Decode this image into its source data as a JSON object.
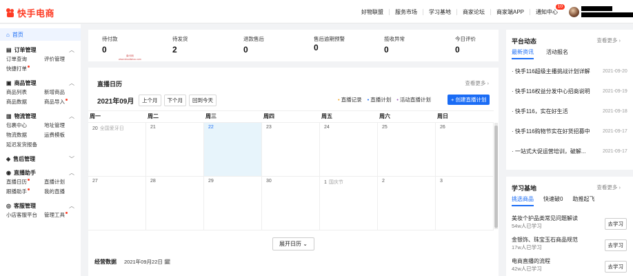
{
  "header": {
    "logo_text": "快手电商",
    "nav": [
      "好物联盟",
      "服务市场",
      "学习基地",
      "商家论坛",
      "商家端APP",
      "通知中心"
    ],
    "notification_count": "10"
  },
  "sidebar": {
    "home": "首页",
    "groups": [
      {
        "title": "订单管理",
        "icon": "order-icon",
        "items": [
          "订单查询",
          "评价管理",
          "快捷打单"
        ],
        "dots": [
          2
        ]
      },
      {
        "title": "商品管理",
        "icon": "product-icon",
        "items": [
          "商品列表",
          "新增商品",
          "商品数据",
          "商品导入"
        ],
        "dots": [
          3
        ]
      },
      {
        "title": "物流管理",
        "icon": "logistics-icon",
        "items": [
          "包裹中心",
          "地址管理",
          "物流数据",
          "运费模板",
          "延迟发货报备"
        ],
        "dots": []
      },
      {
        "title": "售后管理",
        "icon": "after-sale-icon",
        "items": [],
        "dots": []
      },
      {
        "title": "直播助手",
        "icon": "live-icon",
        "items": [
          "直播日历",
          "直播计划",
          "跟播助手",
          "我的直播"
        ],
        "dots": [
          0,
          2
        ]
      },
      {
        "title": "客服管理",
        "icon": "service-icon",
        "items": [
          "小店客服平台",
          "管理工具"
        ],
        "dots": [
          1
        ]
      }
    ]
  },
  "stats": [
    {
      "label": "待付款",
      "value": "0"
    },
    {
      "label": "待发货",
      "value": "2"
    },
    {
      "label": "退款售后",
      "value": "0"
    },
    {
      "label": "售后逾期预警",
      "value": "0"
    },
    {
      "label": "揽收异常",
      "value": "0"
    },
    {
      "label": "今日评价",
      "value": "0"
    }
  ],
  "watermark": [
    "南卡网",
    "www.shoulishou.com"
  ],
  "calendar": {
    "title": "直播日历",
    "more": "查看更多",
    "month": "2021年09月",
    "buttons": [
      "上个月",
      "下个月",
      "回到今天"
    ],
    "legend": [
      "直播记录",
      "直播计划",
      "活动直播计划"
    ],
    "create": "+ 创建直播计划",
    "weekdays": [
      "周一",
      "周二",
      "周三",
      "周四",
      "周五",
      "周六",
      "周日"
    ],
    "rows": [
      [
        {
          "d": "20",
          "h": "全国爱牙日"
        },
        {
          "d": "21"
        },
        {
          "d": "22",
          "today": true
        },
        {
          "d": "23"
        },
        {
          "d": "24"
        },
        {
          "d": "25"
        },
        {
          "d": "26"
        }
      ],
      [
        {
          "d": "27"
        },
        {
          "d": "28"
        },
        {
          "d": "29"
        },
        {
          "d": "30"
        },
        {
          "d": "1",
          "h": "国庆节"
        },
        {
          "d": "2"
        },
        {
          "d": "3"
        }
      ]
    ],
    "expand": "展开日历",
    "ops_title": "经营数据",
    "ops_date": "2021年09月22日"
  },
  "platform": {
    "title": "平台动态",
    "more": "查看更多",
    "tabs": [
      "最新资讯",
      "活动报名"
    ],
    "news": [
      {
        "t": "快手116超级主播挑战计划详解",
        "d": "2021-09-20"
      },
      {
        "t": "快手116权益分发中心招商说明",
        "d": "2021-09-19"
      },
      {
        "t": "快手116，实在好生活",
        "d": "2021-09-18"
      },
      {
        "t": "快手116购物节实在好货招募中",
        "d": "2021-09-17"
      },
      {
        "t": "一站式大促运营培训，破解...",
        "d": "2021-09-17"
      }
    ]
  },
  "learning": {
    "title": "学习基地",
    "more": "查看更多",
    "tabs": [
      "挑选商品",
      "快速破0",
      "助推起飞"
    ],
    "items": [
      {
        "t": "美妆个护品类常见问题解读",
        "s": "54w人已学习",
        "go": "去学习"
      },
      {
        "t": "金银饰、珠宝玉石商品规范",
        "s": "17w人已学习",
        "go": "去学习"
      },
      {
        "t": "电商直播的流程",
        "s": "42w人已学习",
        "go": "去学习"
      }
    ]
  }
}
